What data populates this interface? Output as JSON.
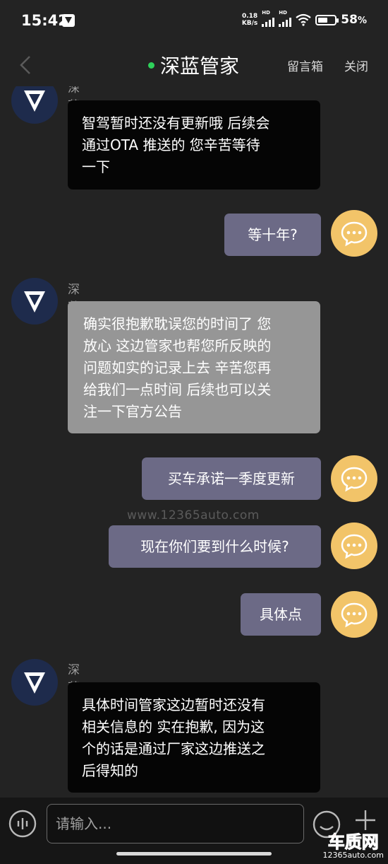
{
  "status_bar": {
    "time": "15:42",
    "net_speed_value": "0.18",
    "net_speed_unit": "KB/s",
    "signal_1_label": "HD",
    "signal_2_label": "HD",
    "battery_percent": "58",
    "battery_unit": "%",
    "battery_level": 0.58
  },
  "nav": {
    "title": "深蓝管家",
    "online_color": "#2ed15a",
    "message_box": "留言箱",
    "close": "关闭"
  },
  "messages": [
    {
      "from": "bot",
      "sender": "深蓝管家",
      "text": "智驾暂时还没有更新哦 后续会\n通过OTA 推送的  您辛苦等待\n一下",
      "style": "dark"
    },
    {
      "from": "user",
      "text": "等十年?"
    },
    {
      "from": "bot",
      "sender": "深蓝管家",
      "text": "确实很抱歉耽误您的时间了 您\n放心 这边管家也帮您所反映的\n问题如实的记录上去 辛苦您再\n给我们一点时间 后续也可以关\n注一下官方公告",
      "style": "grey"
    },
    {
      "from": "user",
      "text": "买车承诺一季度更新"
    },
    {
      "from": "user",
      "text": "现在你们要到什么时候?"
    },
    {
      "from": "user",
      "text": "具体点"
    },
    {
      "from": "bot",
      "sender": "深蓝管家",
      "text": "具体时间管家这边暂时还没有\n相关信息的 实在抱歉, 因为这\n个的话是通过厂家这边推送之\n后得知的",
      "style": "dark"
    }
  ],
  "watermark": "www.12365auto.com",
  "input_bar": {
    "placeholder": "请输入..."
  },
  "corner_logo": {
    "brand": "车质网",
    "url": "12365auto.com"
  },
  "colors": {
    "background": "#232323",
    "user_bubble": "#6c6a86",
    "bot_bubble_dark": "#050505",
    "bot_bubble_grey": "#969696",
    "user_avatar": "#f2c469",
    "bot_avatar": "#1e2b4c"
  }
}
